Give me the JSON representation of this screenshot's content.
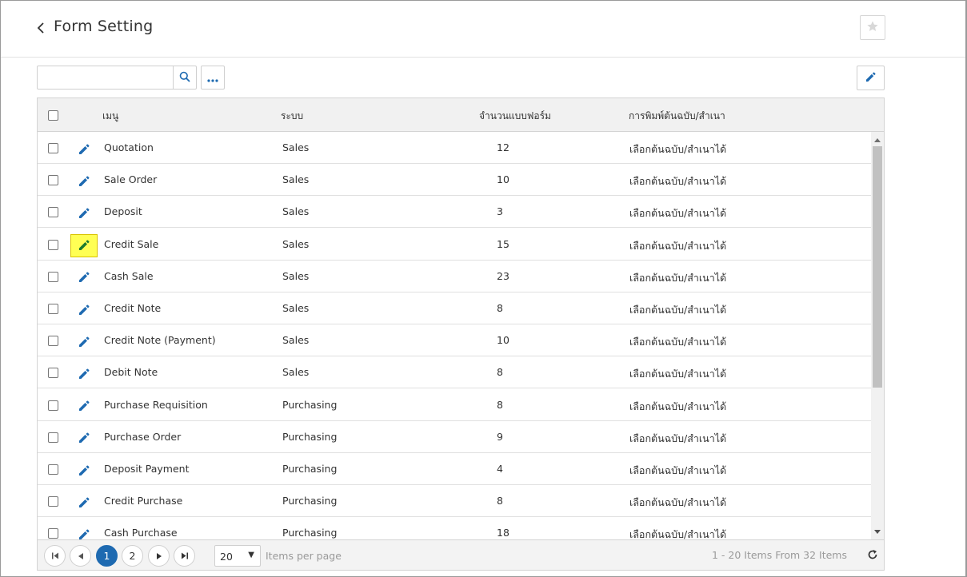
{
  "header": {
    "title": "Form Setting"
  },
  "toolbar": {
    "search_placeholder": ""
  },
  "columns": {
    "menu": "เมนู",
    "system": "ระบบ",
    "form_count": "จำนวนแบบฟอร์ม",
    "print": "การพิมพ์ต้นฉบับ/สำเนา"
  },
  "rows": [
    {
      "menu": "Quotation",
      "system": "Sales",
      "count": "12",
      "print": "เลือกต้นฉบับ/สำเนาได้",
      "highlighted": false
    },
    {
      "menu": "Sale Order",
      "system": "Sales",
      "count": "10",
      "print": "เลือกต้นฉบับ/สำเนาได้",
      "highlighted": false
    },
    {
      "menu": "Deposit",
      "system": "Sales",
      "count": "3",
      "print": "เลือกต้นฉบับ/สำเนาได้",
      "highlighted": false
    },
    {
      "menu": "Credit Sale",
      "system": "Sales",
      "count": "15",
      "print": "เลือกต้นฉบับ/สำเนาได้",
      "highlighted": true
    },
    {
      "menu": "Cash Sale",
      "system": "Sales",
      "count": "23",
      "print": "เลือกต้นฉบับ/สำเนาได้",
      "highlighted": false
    },
    {
      "menu": "Credit Note",
      "system": "Sales",
      "count": "8",
      "print": "เลือกต้นฉบับ/สำเนาได้",
      "highlighted": false
    },
    {
      "menu": "Credit Note (Payment)",
      "system": "Sales",
      "count": "10",
      "print": "เลือกต้นฉบับ/สำเนาได้",
      "highlighted": false
    },
    {
      "menu": "Debit Note",
      "system": "Sales",
      "count": "8",
      "print": "เลือกต้นฉบับ/สำเนาได้",
      "highlighted": false
    },
    {
      "menu": "Purchase Requisition",
      "system": "Purchasing",
      "count": "8",
      "print": "เลือกต้นฉบับ/สำเนาได้",
      "highlighted": false
    },
    {
      "menu": "Purchase Order",
      "system": "Purchasing",
      "count": "9",
      "print": "เลือกต้นฉบับ/สำเนาได้",
      "highlighted": false
    },
    {
      "menu": "Deposit Payment",
      "system": "Purchasing",
      "count": "4",
      "print": "เลือกต้นฉบับ/สำเนาได้",
      "highlighted": false
    },
    {
      "menu": "Credit Purchase",
      "system": "Purchasing",
      "count": "8",
      "print": "เลือกต้นฉบับ/สำเนาได้",
      "highlighted": false
    },
    {
      "menu": "Cash Purchase",
      "system": "Purchasing",
      "count": "18",
      "print": "เลือกต้นฉบับ/สำเนาได้",
      "highlighted": false
    }
  ],
  "pager": {
    "pages": [
      "1",
      "2"
    ],
    "current_page": "1",
    "page_size": "20",
    "items_per_page_label": "Items per page",
    "range_text": "1 - 20 Items From 32 Items"
  },
  "colors": {
    "accent": "#1e6ab1",
    "highlight": "#ffff54",
    "header_bg": "#f1f1f1"
  }
}
